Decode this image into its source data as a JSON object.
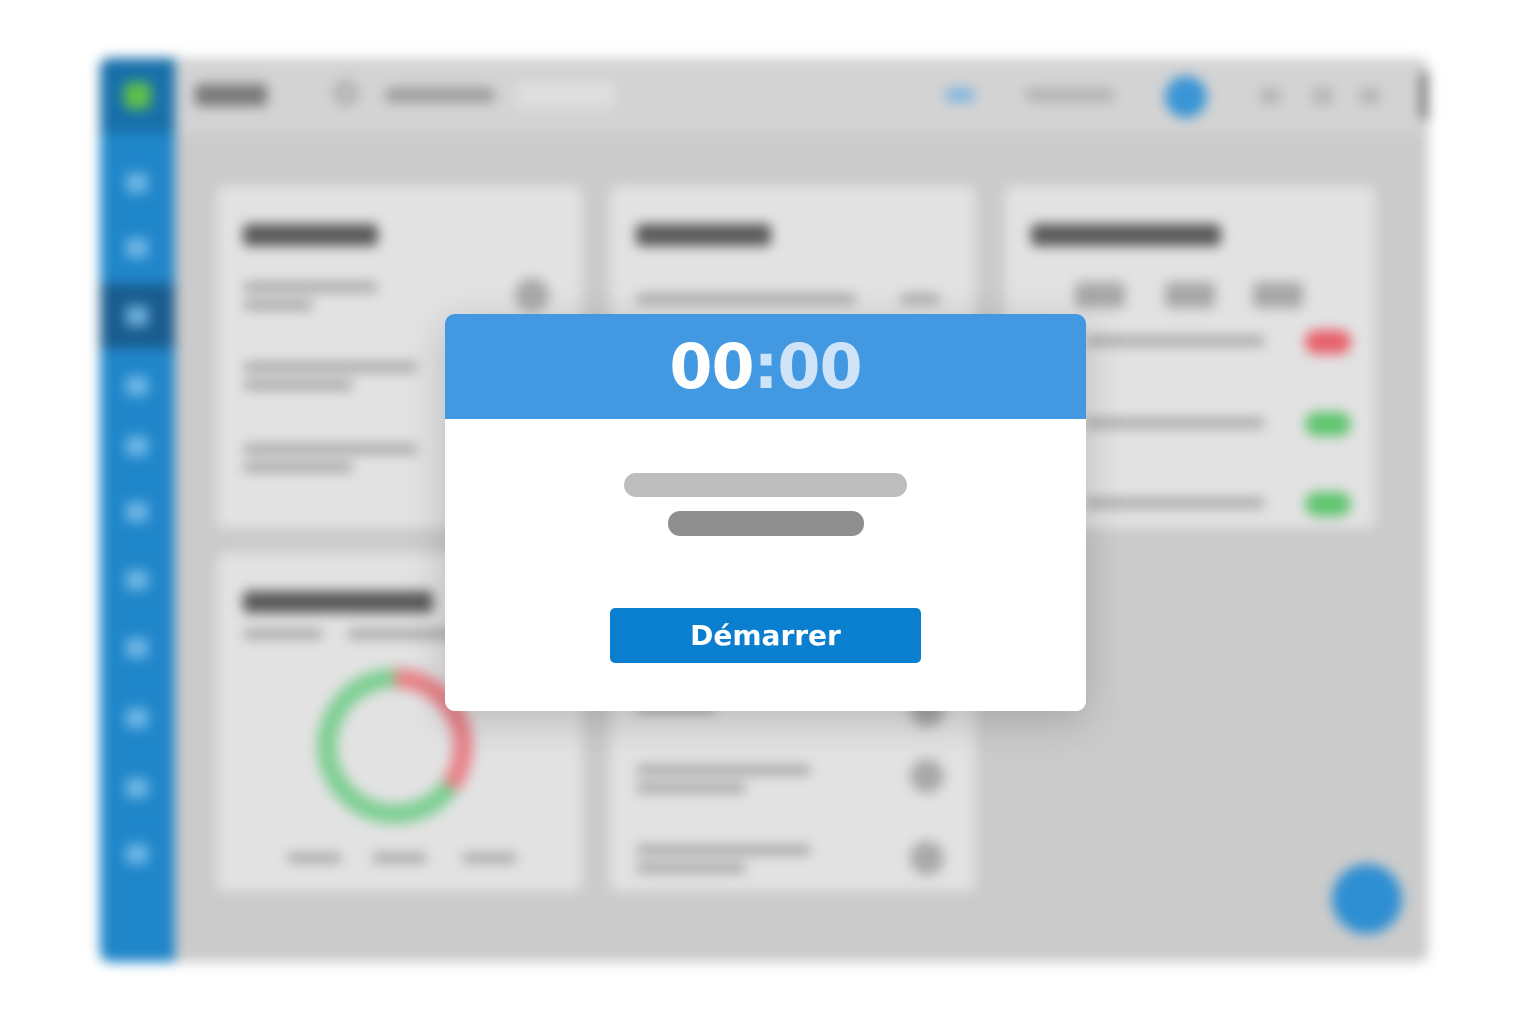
{
  "modal": {
    "timer": {
      "minutes": "00",
      "separator": ":",
      "seconds": "00"
    },
    "start_button_label": "Démarrer"
  },
  "colors": {
    "header_blue": "#4299e1",
    "button_blue": "#0a7fd0",
    "sidebar_blue": "#1f86c9"
  }
}
